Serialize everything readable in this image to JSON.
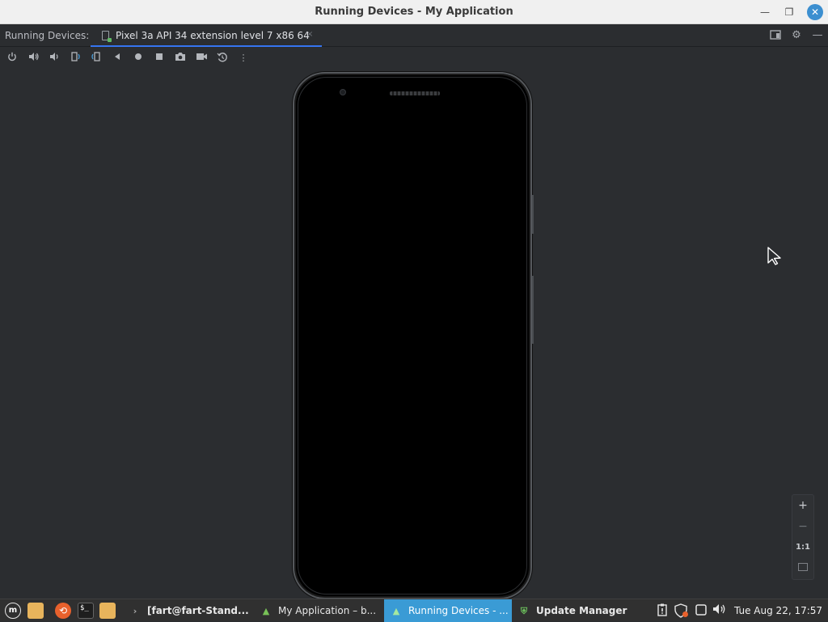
{
  "window": {
    "title": "Running Devices - My Application",
    "minimize_icon": "minimize-icon",
    "maximize_icon": "maximize-icon",
    "close_icon": "close-icon"
  },
  "tabbar": {
    "label": "Running Devices:",
    "tab": {
      "title": "Pixel 3a API 34 extension level 7 x86 64",
      "icon": "device-icon",
      "close": "×"
    },
    "right_icons": [
      "layout-icon",
      "gear-icon",
      "minimize-panel-icon"
    ]
  },
  "toolbar": {
    "buttons": [
      {
        "name": "power-icon",
        "glyph": "⏻"
      },
      {
        "name": "volume-up-icon",
        "glyph": "🔊"
      },
      {
        "name": "volume-down-icon",
        "glyph": "🔉"
      },
      {
        "name": "rotate-left-icon",
        "glyph": "⟲"
      },
      {
        "name": "rotate-right-icon",
        "glyph": "⟳"
      },
      {
        "name": "back-icon",
        "glyph": "◀"
      },
      {
        "name": "home-icon",
        "glyph": "●"
      },
      {
        "name": "overview-icon",
        "glyph": "■"
      },
      {
        "name": "screenshot-icon",
        "glyph": "📷"
      },
      {
        "name": "screen-record-icon",
        "glyph": "🎥"
      },
      {
        "name": "snapshot-icon",
        "glyph": "⟲"
      },
      {
        "name": "more-options-icon",
        "glyph": "⋮"
      }
    ]
  },
  "zoom": {
    "zoom_in": "+",
    "zoom_out": "−",
    "actual_size": "1:1",
    "fit_icon": "zoom-fit-icon"
  },
  "taskbar": {
    "menu_icon": "mint-menu-icon",
    "launchers": [
      "files-icon",
      "firefox-icon",
      "terminal-icon",
      "folder-icon"
    ],
    "items": [
      {
        "label": "[fart@fart-Stand...",
        "icon": "terminal-icon",
        "active": false
      },
      {
        "label": "My Application – b...",
        "icon": "android-studio-icon",
        "active": false
      },
      {
        "label": "Running Devices - ...",
        "icon": "android-studio-icon",
        "active": true
      },
      {
        "label": "Update Manager",
        "icon": "shield-icon",
        "active": false
      }
    ],
    "tray_icons": [
      "clipboard-icon",
      "update-shield-icon",
      "network-icon",
      "volume-icon"
    ],
    "clock": "Tue Aug 22, 17:57"
  },
  "colors": {
    "accent": "#3574f0",
    "taskbar_active": "#3a9bd5",
    "background": "#2b2d30"
  }
}
